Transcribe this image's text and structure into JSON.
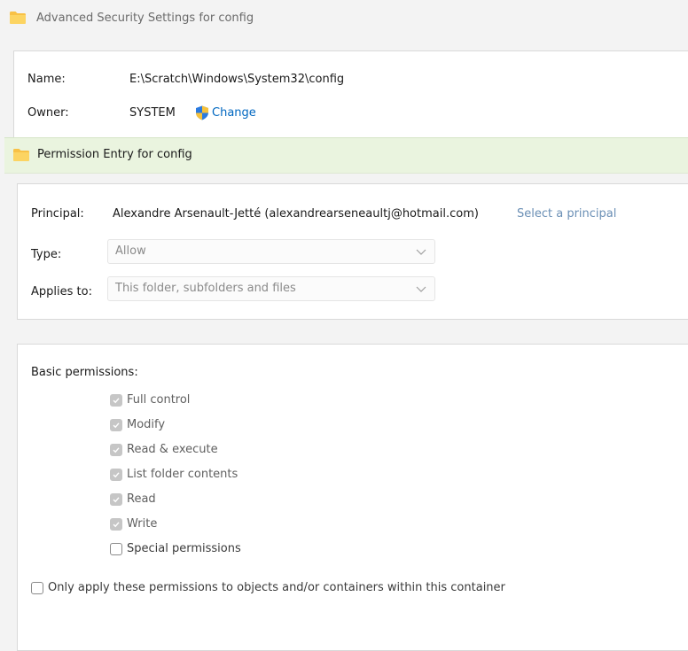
{
  "outer": {
    "title": "Advanced Security Settings for config",
    "name_label": "Name:",
    "name_value": "E:\\Scratch\\Windows\\System32\\config",
    "owner_label": "Owner:",
    "owner_value": "SYSTEM",
    "change_link": "Change"
  },
  "dialog": {
    "title": "Permission Entry for config",
    "principal_label": "Principal:",
    "principal_value": "Alexandre Arsenault-Jetté (alexandrearseneaultj@hotmail.com)",
    "select_principal_link": "Select a principal",
    "type_label": "Type:",
    "type_value": "Allow",
    "applies_label": "Applies to:",
    "applies_value": "This folder, subfolders and files"
  },
  "permissions": {
    "heading": "Basic permissions:",
    "items": [
      {
        "label": "Full control",
        "checked": true
      },
      {
        "label": "Modify",
        "checked": true
      },
      {
        "label": "Read & execute",
        "checked": true
      },
      {
        "label": "List folder contents",
        "checked": true
      },
      {
        "label": "Read",
        "checked": true
      },
      {
        "label": "Write",
        "checked": true
      },
      {
        "label": "Special permissions",
        "checked": false
      }
    ],
    "only_apply_label": "Only apply these permissions to objects and/or containers within this container"
  },
  "colors": {
    "link": "#0067c0",
    "dialog_title_bg": "#eaf4df",
    "folder": "#f8c146"
  },
  "icons": {
    "folder": "folder-icon",
    "shield": "uac-shield-icon",
    "chevron": "chevron-down-icon",
    "check": "checkmark-icon"
  }
}
